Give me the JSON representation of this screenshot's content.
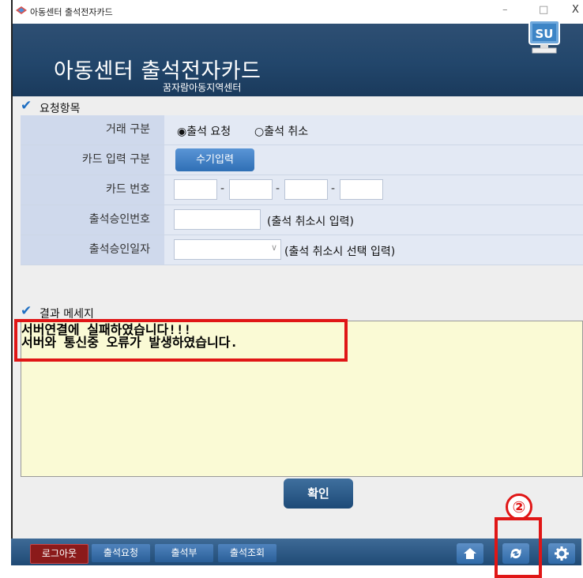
{
  "window": {
    "title": "아동센터 출석전자카드",
    "minimize": "–",
    "maximize": "□",
    "close": "X"
  },
  "header": {
    "title": "아동센터 출석전자카드",
    "subtitle": "꿈자람아동지역센터",
    "logo_text": "SU"
  },
  "request_section": {
    "label": "요청항목",
    "transaction_type": {
      "label": "거래 구분",
      "options": [
        "출석 요청",
        "출석 취소"
      ],
      "selected": "출석 요청"
    },
    "card_input_type": {
      "label": "카드 입력 구분",
      "button": "수기입력"
    },
    "card_number": {
      "label": "카드 번호",
      "parts": [
        "",
        "",
        "",
        ""
      ],
      "separator": "-"
    },
    "approval_number": {
      "label": "출석승인번호",
      "value": "",
      "note": "(출석 취소시 입력)"
    },
    "approval_date": {
      "label": "출석승인일자",
      "value": "",
      "note": "(출석 취소시 선택 입력)"
    }
  },
  "result_section": {
    "label": "결과 메세지",
    "messages": [
      "서버연결에 실패하였습니다!!!",
      "서버와 통신중 오류가 발생하였습니다."
    ]
  },
  "confirm_button": "확인",
  "annotation_marker": "②",
  "bottom_bar": {
    "buttons": [
      "로그아웃",
      "출석요청",
      "출석부",
      "출석조회"
    ],
    "icons": [
      "home-icon",
      "refresh-icon",
      "gear-icon"
    ]
  },
  "colors": {
    "header_bg": "#22466b",
    "accent_blue": "#2f6fb5",
    "logout_red": "#8b1a1a",
    "highlight_red": "#e01616",
    "result_bg": "#fafad5"
  }
}
